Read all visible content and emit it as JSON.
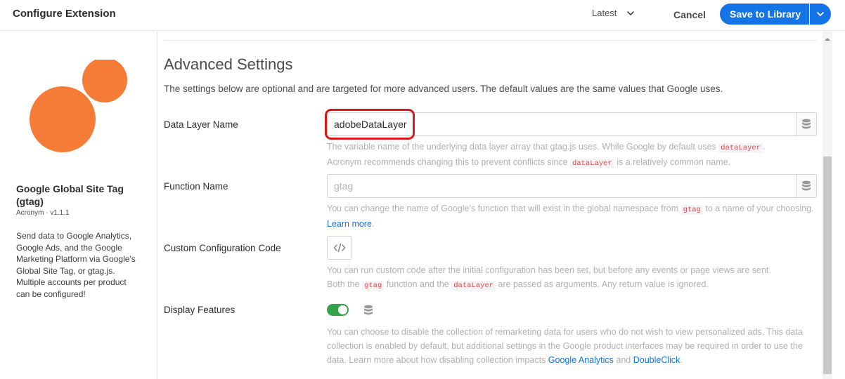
{
  "header": {
    "title": "Configure Extension",
    "version_label": "Latest",
    "cancel_label": "Cancel",
    "save_label": "Save to Library"
  },
  "extension": {
    "name": "Google Global Site Tag (gtag)",
    "vendor": "Acronym · v1.1.1",
    "description": "Send data to Google Analytics, Google Ads, and the Google Marketing Platform via Google's Global Site Tag, or gtag.js. Multiple accounts per product can be configured!"
  },
  "section": {
    "title": "Advanced Settings",
    "description": "The settings below are optional and are targeted for more advanced users. The default values are the same values that Google uses."
  },
  "data_layer": {
    "label": "Data Layer Name",
    "value": "adobeDataLayer",
    "help_1": "The variable name of the underlying data layer array that gtag.js uses. While Google by default uses",
    "code_1": "dataLayer",
    "help_2": ".",
    "help_3": "Acronym recommends changing this to prevent conflicts since",
    "code_2": "dataLayer",
    "help_4": "is a relatively common name."
  },
  "function_name": {
    "label": "Function Name",
    "placeholder": "gtag",
    "help_1": "You can change the name of Google's function that will exist in the global namespace from",
    "code_1": "gtag",
    "help_2": "to a name of your choosing.",
    "link": "Learn more",
    "help_3": "."
  },
  "custom_code": {
    "label": "Custom Configuration Code",
    "help_1": "You can run custom code after the initial configuration has been set, but before any events or page views are sent.",
    "help_2": "Both the",
    "code_1": "gtag",
    "help_3": "function and the",
    "code_2": "dataLayer",
    "help_4": "are passed as arguments. Any return value is ignored."
  },
  "display_features": {
    "label": "Display Features",
    "enabled": true,
    "help_1": "You can choose to disable the collection of remarketing data for users who do not wish to view personalized ads. This data collection is enabled by default, but additional settings in the Google product interfaces may be required in order to use the data. Learn more about how disabling collection impacts",
    "link_1": "Google Analytics",
    "help_2": "and",
    "link_2": "DoubleClick",
    "help_3": "."
  },
  "colors": {
    "accent": "#1473e6",
    "toggle_on": "#33a34a",
    "logo": "#f47c37",
    "highlight": "#d7191c",
    "code": "#e34850"
  }
}
